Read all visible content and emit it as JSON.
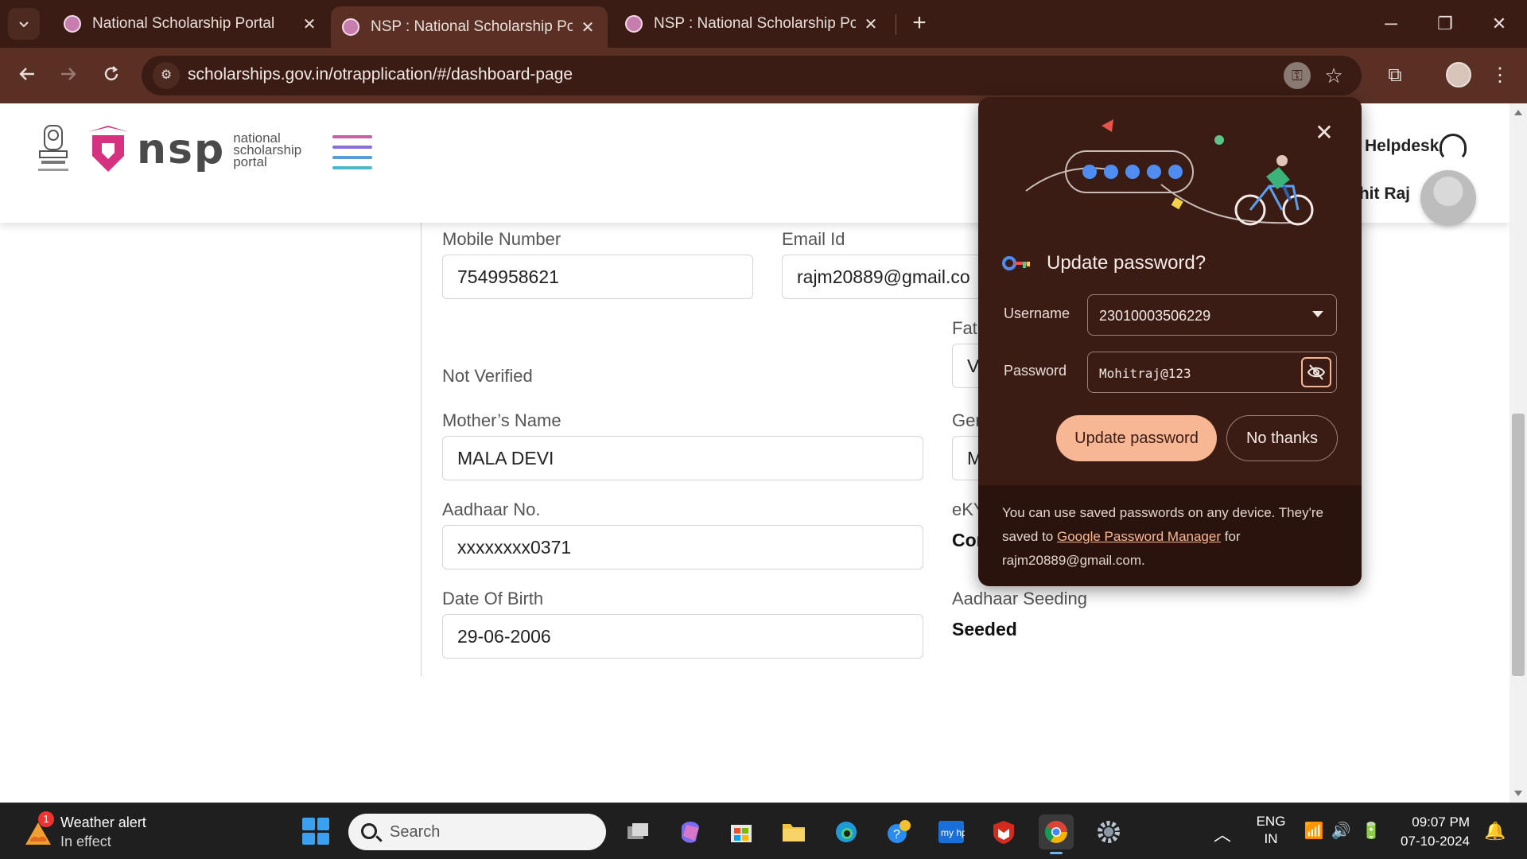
{
  "browser": {
    "tabs": [
      {
        "title": "National Scholarship Portal",
        "active": false
      },
      {
        "title": "NSP : National Scholarship Portal",
        "active": true
      },
      {
        "title": "NSP : National Scholarship Portal",
        "active": false
      }
    ],
    "url": "scholarships.gov.in/otrapplication/#/dashboard-page"
  },
  "site": {
    "logo_text": "nsp",
    "logo_sub": [
      "national",
      "scholarship",
      "portal"
    ],
    "helpdesk": "Helpdesk",
    "user_name": "ohit Raj"
  },
  "form": {
    "mobile": {
      "label": "Mobile Number",
      "value": "7549958621"
    },
    "email": {
      "label": "Email Id",
      "value": "rajm20889@gmail.co"
    },
    "father_label": "Fat",
    "father_value": "V",
    "verification_status": "Not Verified",
    "mother": {
      "label": "Mother’s Name",
      "value": "MALA DEVI"
    },
    "gender_label": "Ger",
    "gender_value": "M",
    "aadhaar": {
      "label": "Aadhaar No.",
      "value": "xxxxxxxx0371"
    },
    "ekyc_label": "eKY",
    "ekyc_value": "Cor",
    "dob": {
      "label": "Date Of Birth",
      "value": "29-06-2006"
    },
    "seeding": {
      "label": "Aadhaar Seeding",
      "value": "Seeded"
    }
  },
  "password_popup": {
    "title": "Update password?",
    "username_label": "Username",
    "username_value": "23010003506229",
    "password_label": "Password",
    "password_value": "Mohitraj@123",
    "update_button": "Update password",
    "no_thanks_button": "No thanks",
    "footer_prefix": "You can use saved passwords on any device. They're saved to ",
    "footer_link": "Google Password Manager",
    "footer_suffix": " for",
    "footer_email": "rajm20889@gmail.com."
  },
  "taskbar": {
    "weather_title": "Weather alert",
    "weather_sub": "In effect",
    "weather_badge": "1",
    "search_placeholder": "Search",
    "lang_top": "ENG",
    "lang_bottom": "IN",
    "time": "09:07 PM",
    "date": "07-10-2024"
  },
  "colors": {
    "chrome_dark": "#3a1c14",
    "chrome_toolbar": "#5a3025",
    "accent_peach": "#f8b794",
    "nsp_pink": "#d6327f"
  }
}
